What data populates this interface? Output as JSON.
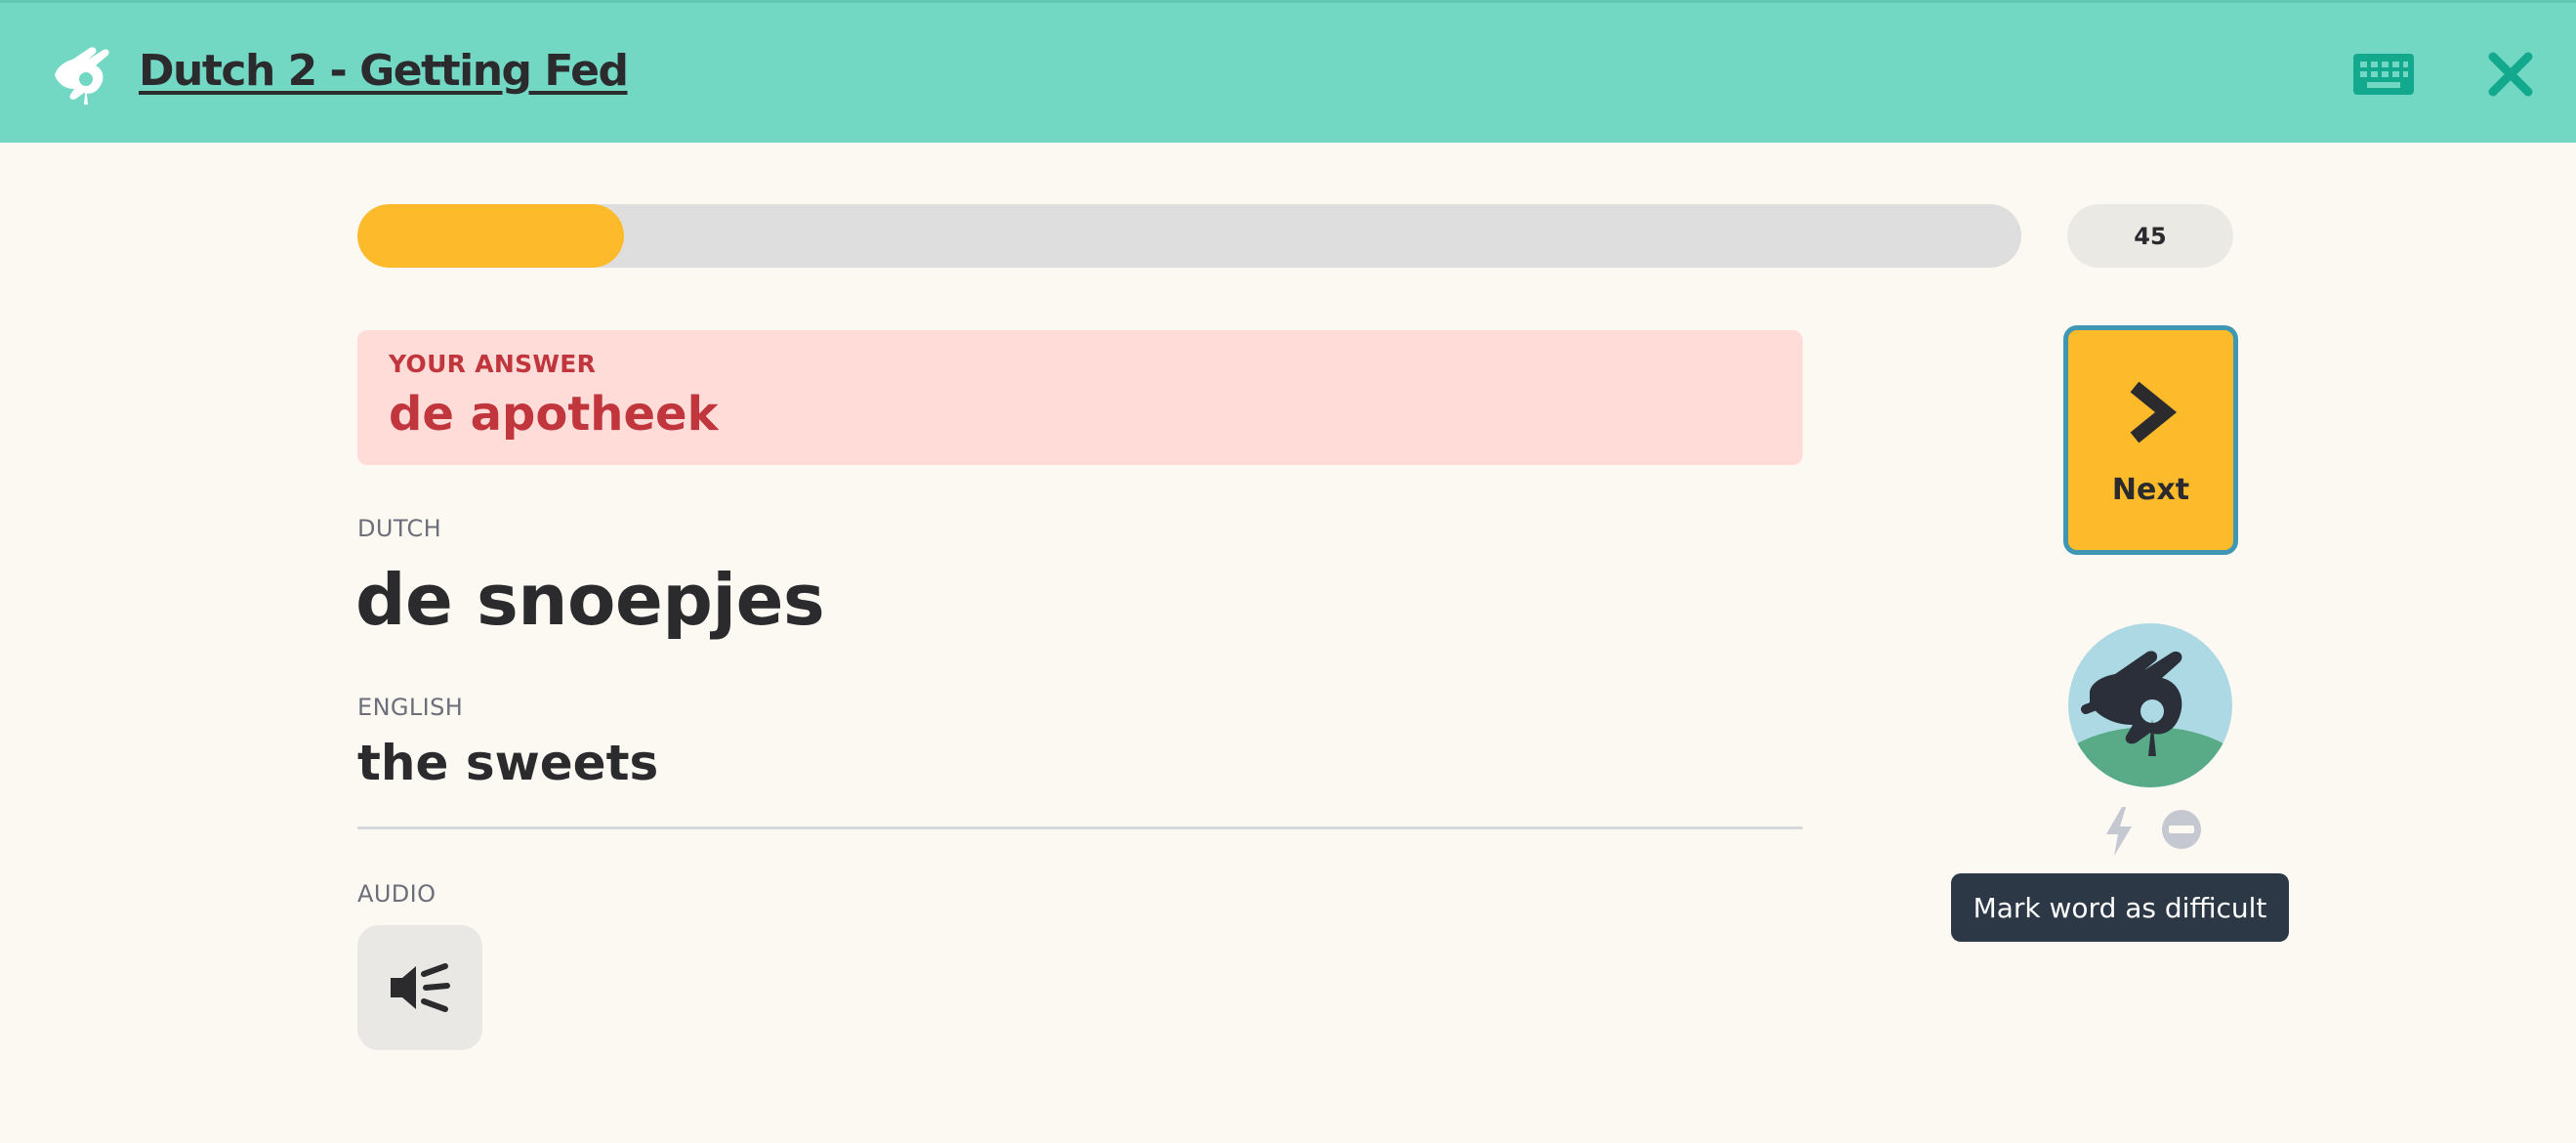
{
  "header": {
    "course_title": "Dutch 2 - Getting Fed",
    "logo_icon": "memrise-hand-icon",
    "keyboard_icon": "keyboard-icon",
    "close_icon": "close-icon",
    "accent_color": "#72d7c3"
  },
  "progress": {
    "fraction": 0.16,
    "score": "45",
    "fill_color": "#fdbb2b"
  },
  "answer": {
    "label": "YOUR ANSWER",
    "value": "de apotheek",
    "status_color": "#c0363c"
  },
  "word": {
    "dutch_label": "DUTCH",
    "dutch_value": "de snoepjes",
    "english_label": "ENGLISH",
    "english_value": "the sweets",
    "audio_label": "AUDIO",
    "audio_icon": "speaker-icon"
  },
  "sidebar": {
    "next_label": "Next",
    "next_icon": "chevron-right-icon",
    "avatar_icon": "memory-plant-icon",
    "bolt_icon": "lightning-icon",
    "ignore_icon": "ignore-icon",
    "tooltip": "Mark word as difficult"
  }
}
